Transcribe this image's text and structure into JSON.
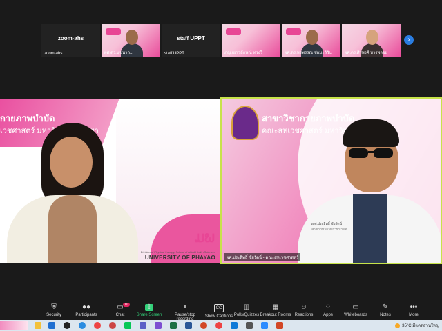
{
  "thumbnails": [
    {
      "center": "zoom-ahs",
      "name": "zoom-ahs",
      "kind": "name-only"
    },
    {
      "center": "",
      "name": "ผศ.ดร.นุชนาถ...",
      "kind": "video"
    },
    {
      "center": "staff UPPT",
      "name": "staff UPPT",
      "kind": "name-only"
    },
    {
      "center": "",
      "name": "ภญ.เยาวลักษณ์ ทรงวี",
      "kind": "video"
    },
    {
      "center": "",
      "name": "ผศ.ดร.พรพรรณ ช่อมะลิวัน",
      "kind": "video"
    },
    {
      "center": "",
      "name": "ผศ.ดร.ศิรพงศ์ บางพลอย",
      "kind": "video"
    }
  ],
  "next_button": "›",
  "left_tile": {
    "thai_line1": "กายภาพบำบัด",
    "thai_line2": "เวชศาสตร์ มหาวิทยาลัยพะเยา",
    "logo": "ມພ",
    "caption": "Division of Physical therapy, School of Allied Health Sciences",
    "university": "UNIVERSITY OF PHAYAO"
  },
  "right_tile": {
    "thai_line1": "สาขาวิชากายภาพบำบัด",
    "thai_line2": "คณะสหเวชศาสตร์ มหาวิทยาลัย",
    "badge_line1": "ผ.ศ.ประสิทธิ์ ชัยรัตน์",
    "badge_line2": "สาขาวิชากายภาพบำบัด",
    "name_tag": "ผศ.ประสิทธิ์ ชัยรัตน์ - คณะสหเวชศาสตร์"
  },
  "toolbar": [
    {
      "label": "Security",
      "icon": "shield-icon",
      "glyph": "⛨"
    },
    {
      "label": "Participants",
      "icon": "participants-icon",
      "glyph": "👥"
    },
    {
      "label": "Chat",
      "icon": "chat-icon",
      "glyph": "💬",
      "badge": "10"
    },
    {
      "label": "Share Screen",
      "icon": "share-screen-icon",
      "glyph": "⇪"
    },
    {
      "label": "Pause/stop recording",
      "icon": "pause-icon",
      "glyph": "⏸"
    },
    {
      "label": "Show Captions",
      "icon": "captions-icon",
      "glyph": "CC"
    },
    {
      "label": "Polls/Quizzes",
      "icon": "polls-icon",
      "glyph": "▥"
    },
    {
      "label": "Breakout Rooms",
      "icon": "breakout-icon",
      "glyph": "▦"
    },
    {
      "label": "Reactions",
      "icon": "reactions-icon",
      "glyph": "☺"
    },
    {
      "label": "Apps",
      "icon": "apps-icon",
      "glyph": "⁘"
    },
    {
      "label": "Whiteboards",
      "icon": "whiteboard-icon",
      "glyph": "▭"
    },
    {
      "label": "Notes",
      "icon": "notes-icon",
      "glyph": "✎"
    },
    {
      "label": "More",
      "icon": "more-icon",
      "glyph": "•••"
    }
  ],
  "taskbar": {
    "temperature": "35°C",
    "weather": "มีแดดส่วนใหญ่"
  },
  "colors": {
    "accent_pink": "#e84695",
    "active_speaker_border": "#c7e34a",
    "share_green": "#33d17a"
  }
}
